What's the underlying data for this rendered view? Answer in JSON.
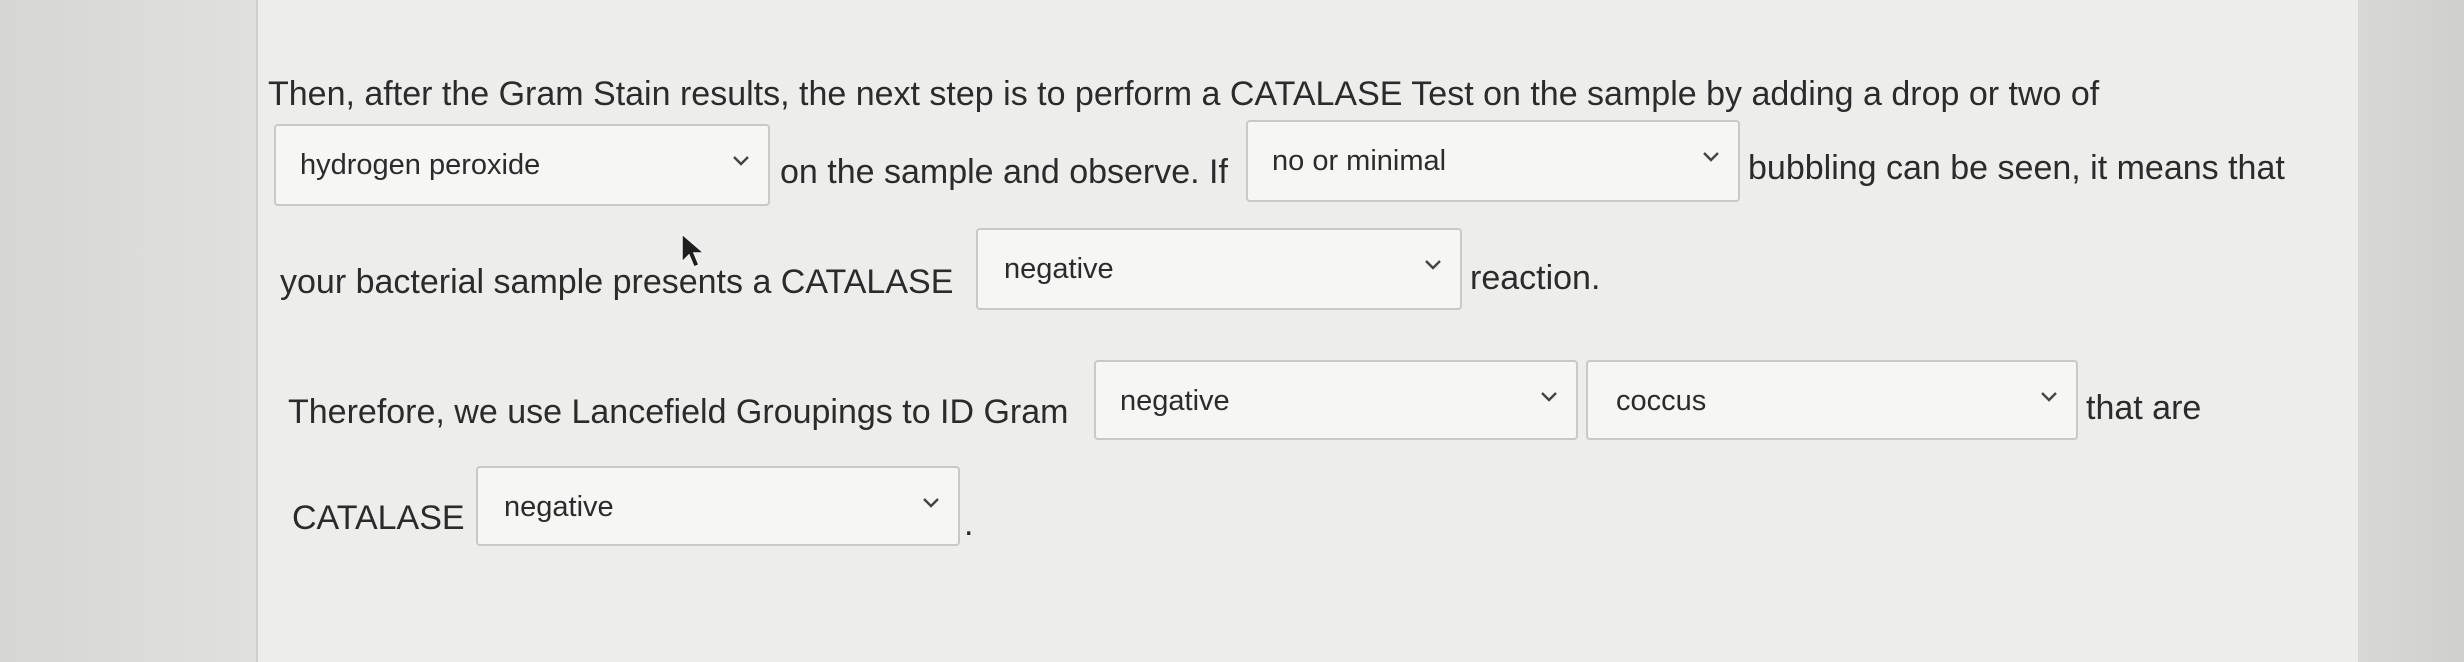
{
  "paragraph": {
    "line1": "Then, after the Gram Stain results, the next step is to perform a CATALASE Test on the sample by adding a drop or two of",
    "line2_mid": "on the sample and observe. If",
    "line2_end": "bubbling can be seen, it means that",
    "line3_start": "your bacterial sample presents a CATALASE",
    "line3_end": "reaction.",
    "line4_start": "Therefore, we use Lancefield Groupings to ID Gram",
    "line4_end": "that are",
    "line5_start": "CATALASE",
    "line5_end": "."
  },
  "dropdowns": {
    "reagent": {
      "selected": "hydrogen peroxide"
    },
    "bubbling": {
      "selected": "no or minimal"
    },
    "catalase_result": {
      "selected": "negative"
    },
    "gram_type": {
      "selected": "negative"
    },
    "morphology": {
      "selected": "coccus"
    },
    "catalase_final": {
      "selected": "negative"
    }
  },
  "icons": {
    "chevron": "chevron-down-icon",
    "cursor": "mouse-pointer-icon"
  }
}
